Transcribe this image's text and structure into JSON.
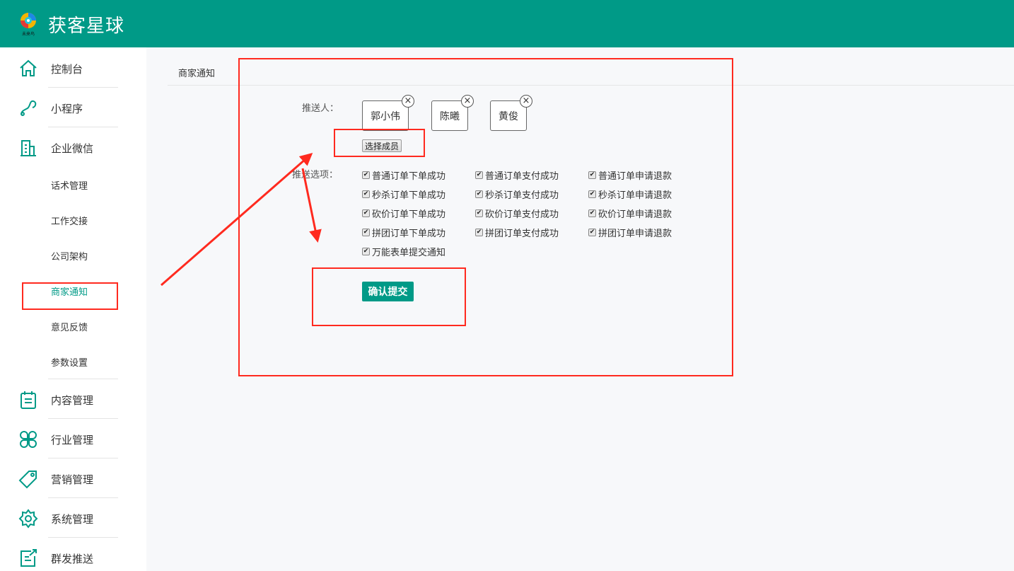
{
  "header": {
    "title": "获客星球",
    "logo_text": "未来鸟"
  },
  "sidebar": {
    "items": [
      {
        "label": "控制台",
        "icon": "home-icon"
      },
      {
        "label": "小程序",
        "icon": "mini-program-icon"
      },
      {
        "label": "企业微信",
        "icon": "building-icon"
      }
    ],
    "sub_items": [
      {
        "label": "话术管理"
      },
      {
        "label": "工作交接"
      },
      {
        "label": "公司架构"
      },
      {
        "label": "商家通知",
        "active": true
      },
      {
        "label": "意见反馈"
      },
      {
        "label": "参数设置"
      }
    ],
    "items2": [
      {
        "label": "内容管理",
        "icon": "clipboard-icon"
      },
      {
        "label": "行业管理",
        "icon": "clover-icon"
      },
      {
        "label": "营销管理",
        "icon": "tag-icon"
      },
      {
        "label": "系统管理",
        "icon": "gear-icon"
      },
      {
        "label": "群发推送",
        "icon": "send-icon"
      }
    ]
  },
  "main": {
    "tab": "商家通知",
    "push_people_label": "推送人：",
    "people": [
      "郭小伟",
      "陈曦",
      "黄俊"
    ],
    "select_members": "选择成员",
    "push_options_label": "推送选项：",
    "options": [
      [
        "普通订单下单成功",
        "普通订单支付成功",
        "普通订单申请退款"
      ],
      [
        "秒杀订单下单成功",
        "秒杀订单支付成功",
        "秒杀订单申请退款"
      ],
      [
        "砍价订单下单成功",
        "砍价订单支付成功",
        "砍价订单申请退款"
      ],
      [
        "拼团订单下单成功",
        "拼团订单支付成功",
        "拼团订单申请退款"
      ],
      [
        "万能表单提交通知"
      ]
    ],
    "submit": "确认提交"
  },
  "colors": {
    "brand": "#009a87",
    "annotation": "#ff2a1f"
  }
}
